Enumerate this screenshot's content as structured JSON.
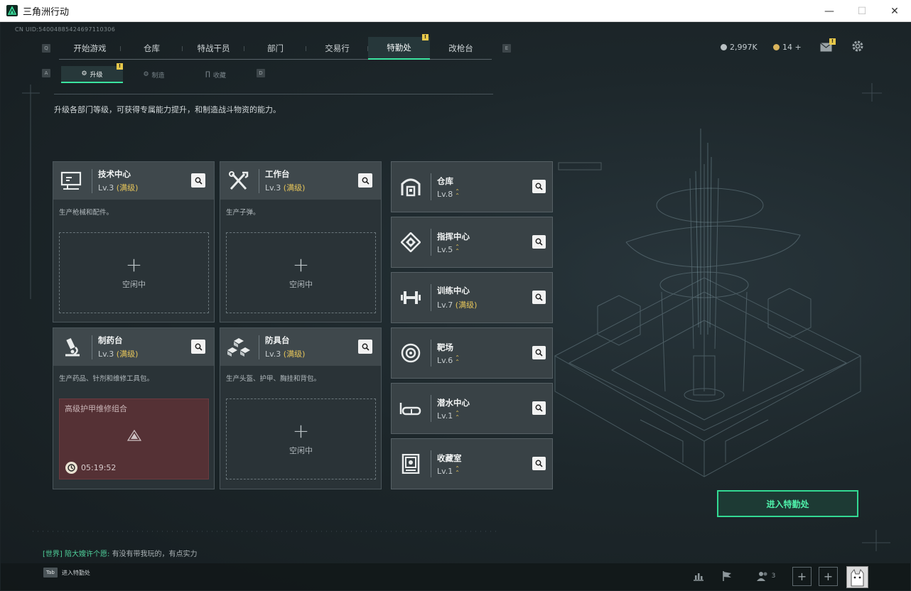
{
  "window": {
    "title": "三角洲行动"
  },
  "uid": "CN UID:54004885424697110306",
  "nav": {
    "left_key": "Q",
    "right_key": "E",
    "tabs": [
      "开始游戏",
      "仓库",
      "特战干员",
      "部门",
      "交易行",
      "特勤处",
      "改枪台"
    ],
    "active_tab": "特勤处",
    "tab_badge": "!"
  },
  "currency": {
    "coins": "2,997K",
    "tickets": "14 +"
  },
  "mail_badge": "!",
  "subnav": {
    "left_key": "A",
    "right_key": "D",
    "tabs": [
      "升级",
      "制造",
      "收藏"
    ],
    "active_tab": "升级",
    "badge": "!"
  },
  "description": "升级各部门等级，可获得专属能力提升，和制造战斗物资的能力。",
  "production_cards": [
    {
      "name": "技术中心",
      "level": "Lv.3",
      "max": "(满级)",
      "desc": "生产枪械和配件。",
      "slot_plus": "+",
      "slot_status": "空闲中",
      "icon": "computer-icon"
    },
    {
      "name": "工作台",
      "level": "Lv.3",
      "max": "(满级)",
      "desc": "生产子弹。",
      "slot_plus": "+",
      "slot_status": "空闲中",
      "icon": "tools-icon"
    },
    {
      "name": "制药台",
      "level": "Lv.3",
      "max": "(满级)",
      "desc": "生产药品、针剂和维修工具包。",
      "job": "高级护甲维修组合",
      "timer": "05:19:52",
      "icon": "microscope-icon"
    },
    {
      "name": "防具台",
      "level": "Lv.3",
      "max": "(满级)",
      "desc": "生产头盔、护甲、胸挂和背包。",
      "slot_plus": "+",
      "slot_status": "空闲中",
      "icon": "cubes-icon"
    }
  ],
  "departments": [
    {
      "name": "仓库",
      "level": "Lv.8",
      "max": "",
      "upgradable": true,
      "icon": "warehouse-icon"
    },
    {
      "name": "指挥中心",
      "level": "Lv.5",
      "max": "",
      "upgradable": true,
      "icon": "command-icon"
    },
    {
      "name": "训练中心",
      "level": "Lv.7",
      "max": "(满级)",
      "upgradable": false,
      "icon": "dumbbell-icon"
    },
    {
      "name": "靶场",
      "level": "Lv.6",
      "max": "",
      "upgradable": true,
      "icon": "target-icon"
    },
    {
      "name": "潜水中心",
      "level": "Lv.1",
      "max": "",
      "upgradable": true,
      "icon": "diving-mask-icon"
    },
    {
      "name": "收藏室",
      "level": "Lv.1",
      "max": "",
      "upgradable": true,
      "icon": "collection-icon"
    }
  ],
  "enter_button": "进入特勤处",
  "chat": {
    "channel": "[世界]",
    "user": "陪大嫂许个愿:",
    "message": "有没有带我玩的，有点实力"
  },
  "bottom": {
    "tab_key": "Tab",
    "tab_label": "进入特勤处",
    "friends_count": "3",
    "add1": "+",
    "add2": "+"
  },
  "colors": {
    "accent": "#3be4a0",
    "max_level": "#e6c55a",
    "busy_slot": "#553135"
  }
}
